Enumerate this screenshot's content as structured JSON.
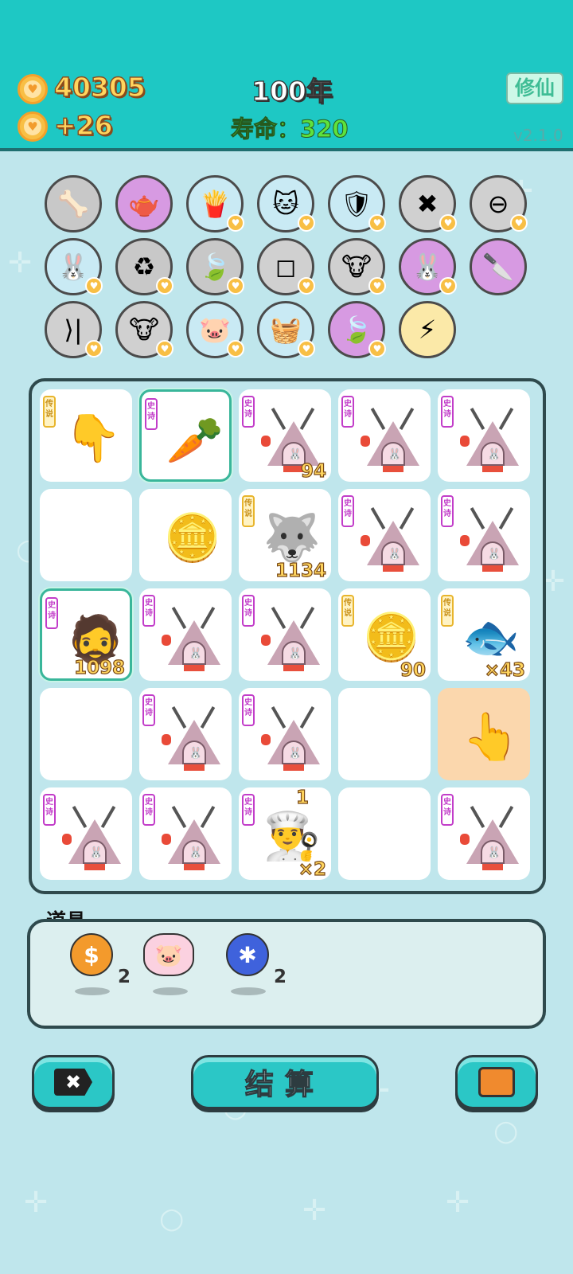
{
  "header": {
    "coins": "40305",
    "income": "+26",
    "year": "100年",
    "lifespan_label": "寿命：",
    "lifespan_value": "320",
    "cultivate_button": "修仙",
    "version": "v2.1.0"
  },
  "skills": [
    {
      "icon": "pet-food-bowl-icon",
      "bg": "#c8c8c8",
      "glyph": "🦴"
    },
    {
      "icon": "gravy-boat-icon",
      "bg": "#d79ae2",
      "glyph": "🫖"
    },
    {
      "icon": "french-fries-icon",
      "bg": "#c9eaf4",
      "glyph": "🍟"
    },
    {
      "icon": "cat-scratch-icon",
      "bg": "#c9eaf4",
      "glyph": "🐱"
    },
    {
      "icon": "shield-wrench-icon",
      "bg": "#c9eaf4",
      "glyph": "🛡"
    },
    {
      "icon": "cancel-tag-icon",
      "bg": "#d0d0d0",
      "glyph": "✖"
    },
    {
      "icon": "minus-circle-icon",
      "bg": "#d0d0d0",
      "glyph": "⊖"
    },
    {
      "icon": "bunny-icon",
      "bg": "#c9eaf4",
      "glyph": "🐰"
    },
    {
      "icon": "refresh-arrows-icon",
      "bg": "#c8c8c8",
      "glyph": "♻"
    },
    {
      "icon": "leaf-icon",
      "bg": "#c8c8c8",
      "glyph": "🍃"
    },
    {
      "icon": "sugar-cubes-icon",
      "bg": "#d0d0d0",
      "glyph": "◻"
    },
    {
      "icon": "twin-cows-icon",
      "bg": "#d0d0d0",
      "glyph": "🐮"
    },
    {
      "icon": "bunny-purple-icon",
      "bg": "#d79ae2",
      "glyph": "🐰"
    },
    {
      "icon": "cleaver-icon",
      "bg": "#d79ae2",
      "glyph": "🔪"
    },
    {
      "icon": "skip-end-icon",
      "bg": "#d0d0d0",
      "glyph": "⟩|"
    },
    {
      "icon": "twin-cows-small-icon",
      "bg": "#d0d0d0",
      "glyph": "🐮"
    },
    {
      "icon": "piggy-bank-icon",
      "bg": "#c9eaf4",
      "glyph": "🐷"
    },
    {
      "icon": "fruit-basket-icon",
      "bg": "#c9eaf4",
      "glyph": "🧺"
    },
    {
      "icon": "leaf-purple-icon",
      "bg": "#d79ae2",
      "glyph": "🍃"
    },
    {
      "icon": "lightning-icon",
      "bg": "#fbe9a8",
      "glyph": "⚡"
    }
  ],
  "board": {
    "tag_epic": "史诗",
    "tag_legend": "传说",
    "cells": [
      {
        "type": "pointer-down",
        "tag": "legend",
        "count": ""
      },
      {
        "type": "carrot",
        "tag": "epic",
        "count": "",
        "selected": true
      },
      {
        "type": "tent",
        "tag": "epic",
        "count": "94"
      },
      {
        "type": "tent",
        "tag": "epic",
        "count": ""
      },
      {
        "type": "tent",
        "tag": "epic",
        "count": ""
      },
      {
        "type": "empty",
        "tag": "",
        "count": ""
      },
      {
        "type": "coin-pile",
        "tag": "",
        "count": ""
      },
      {
        "type": "husky-king",
        "tag": "legend",
        "count": "1134"
      },
      {
        "type": "tent",
        "tag": "epic",
        "count": ""
      },
      {
        "type": "tent",
        "tag": "epic",
        "count": ""
      },
      {
        "type": "bald-man",
        "tag": "epic",
        "count": "1098",
        "selected": true
      },
      {
        "type": "tent",
        "tag": "epic",
        "count": ""
      },
      {
        "type": "tent",
        "tag": "epic",
        "count": ""
      },
      {
        "type": "coin-stack",
        "tag": "legend",
        "count": "90"
      },
      {
        "type": "koi-fish",
        "tag": "legend",
        "count": "×43"
      },
      {
        "type": "empty",
        "tag": "",
        "count": ""
      },
      {
        "type": "tent",
        "tag": "epic",
        "count": ""
      },
      {
        "type": "tent",
        "tag": "epic",
        "count": ""
      },
      {
        "type": "empty",
        "tag": "",
        "count": ""
      },
      {
        "type": "pointer-up",
        "tag": "",
        "count": "",
        "peach": true
      },
      {
        "type": "tent",
        "tag": "epic",
        "count": ""
      },
      {
        "type": "tent",
        "tag": "epic",
        "count": ""
      },
      {
        "type": "chef",
        "tag": "epic",
        "count": "×2",
        "bonus": "1"
      },
      {
        "type": "empty",
        "tag": "",
        "count": ""
      },
      {
        "type": "tent",
        "tag": "epic",
        "count": ""
      }
    ]
  },
  "props": {
    "title": "道具",
    "items": [
      {
        "icon": "dollar-coin-icon",
        "count": "2"
      },
      {
        "icon": "piggy-bank-icon",
        "count": ""
      },
      {
        "icon": "blueberry-icon",
        "count": "2"
      }
    ]
  },
  "buttons": {
    "remove": "✖",
    "settle": "结算",
    "bag": ""
  }
}
